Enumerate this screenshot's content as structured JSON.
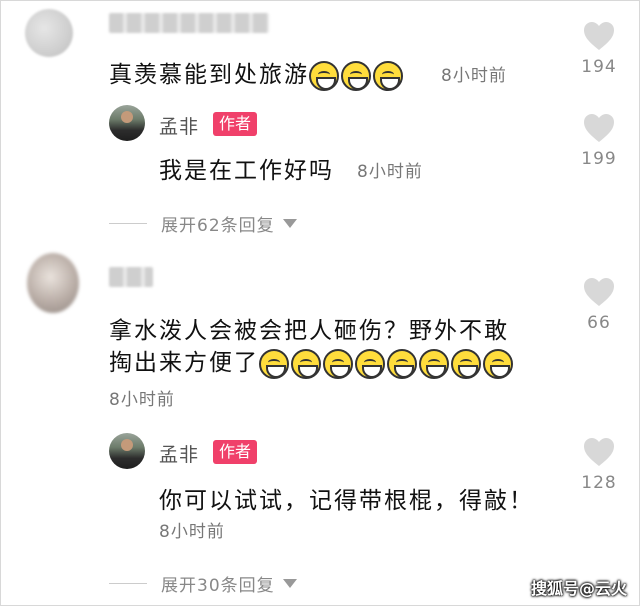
{
  "comments": [
    {
      "text": "真羡慕能到处旅游",
      "emoji_count": 3,
      "time": "8小时前",
      "likes": "194",
      "reply": {
        "author": "孟非",
        "badge": "作者",
        "text": "我是在工作好吗",
        "time": "8小时前",
        "likes": "199"
      },
      "expand_label": "展开62条回复"
    },
    {
      "text_line1": "拿水泼人会被会把人砸伤？野外不敢",
      "text_line2": "掏出来方便了",
      "emoji_count": 8,
      "time": "8小时前",
      "likes": "66",
      "reply": {
        "author": "孟非",
        "badge": "作者",
        "text": "你可以试试，记得带根棍，得敲！",
        "time": "8小时前",
        "likes": "128"
      },
      "expand_label": "展开30条回复"
    }
  ],
  "watermark": "搜狐号@云火",
  "icons": {
    "like": "heart-icon",
    "expand": "triangle-down-icon",
    "emoji": "grinning-emoji-icon"
  },
  "colors": {
    "badge": "#f0406a",
    "heart": "#d8d8d8",
    "emoji": "#ffdd3c"
  }
}
